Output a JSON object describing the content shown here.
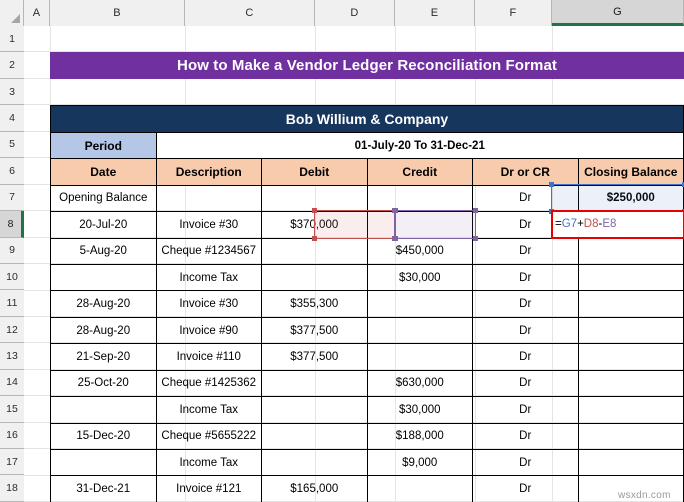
{
  "app": {
    "type": "spreadsheet",
    "watermark": "wsxdn.com"
  },
  "grid": {
    "columns": [
      {
        "letter": "A",
        "width": 26
      },
      {
        "letter": "B",
        "width": 135
      },
      {
        "letter": "C",
        "width": 130
      },
      {
        "letter": "D",
        "width": 80
      },
      {
        "letter": "E",
        "width": 80
      },
      {
        "letter": "F",
        "width": 77
      },
      {
        "letter": "G",
        "width": 132
      }
    ],
    "selected_column": "G",
    "rows": [
      1,
      2,
      3,
      4,
      5,
      6,
      7,
      8,
      9,
      10,
      11,
      12,
      13,
      14,
      15,
      16,
      17,
      18
    ],
    "selected_row": 8,
    "active_cell": "G8"
  },
  "banner": {
    "title": "How to Make a Vendor Ledger Reconciliation Format",
    "background": "#7030A0",
    "text_color": "#FFFFFF"
  },
  "colors": {
    "company_header_bg": "#17365D",
    "period_label_bg": "#B4C7E7",
    "column_header_bg": "#F8CBAD",
    "active_border": "#E60000",
    "ref_blue": "#4472C4",
    "ref_red": "#C0504D",
    "ref_purple": "#8064A2",
    "selection_green": "#217346"
  },
  "sheet": {
    "company_name": "Bob Willium & Company",
    "period_label": "Period",
    "period_value": "01-July-20 To 31-Dec-21",
    "headers": [
      "Date",
      "Description",
      "Debit",
      "Credit",
      "Dr or CR",
      "Closing Balance"
    ],
    "rows": [
      {
        "row": 7,
        "date": "Opening Balance",
        "description": "",
        "debit": "",
        "credit": "",
        "drcr": "Dr",
        "closing": "$250,000"
      },
      {
        "row": 8,
        "date": "20-Jul-20",
        "description": "Invoice #30",
        "debit": "$370,000",
        "credit": "",
        "drcr": "Dr",
        "closing": "=G7+D8-E8"
      },
      {
        "row": 9,
        "date": "5-Aug-20",
        "description": "Cheque #1234567",
        "debit": "",
        "credit": "$450,000",
        "drcr": "Dr",
        "closing": ""
      },
      {
        "row": 10,
        "date": "",
        "description": "Income Tax",
        "debit": "",
        "credit": "$30,000",
        "drcr": "Dr",
        "closing": ""
      },
      {
        "row": 11,
        "date": "28-Aug-20",
        "description": "Invoice #30",
        "debit": "$355,300",
        "credit": "",
        "drcr": "Dr",
        "closing": ""
      },
      {
        "row": 12,
        "date": "28-Aug-20",
        "description": "Invoice #90",
        "debit": "$377,500",
        "credit": "",
        "drcr": "Dr",
        "closing": ""
      },
      {
        "row": 13,
        "date": "21-Sep-20",
        "description": "Invoice #110",
        "debit": "$377,500",
        "credit": "",
        "drcr": "Dr",
        "closing": ""
      },
      {
        "row": 14,
        "date": "25-Oct-20",
        "description": "Cheque #1425362",
        "debit": "",
        "credit": "$630,000",
        "drcr": "Dr",
        "closing": ""
      },
      {
        "row": 15,
        "date": "",
        "description": "Income Tax",
        "debit": "",
        "credit": "$30,000",
        "drcr": "Dr",
        "closing": ""
      },
      {
        "row": 16,
        "date": "15-Dec-20",
        "description": "Cheque #5655222",
        "debit": "",
        "credit": "$188,000",
        "drcr": "Dr",
        "closing": ""
      },
      {
        "row": 17,
        "date": "",
        "description": "Income Tax",
        "debit": "",
        "credit": "$9,000",
        "drcr": "Dr",
        "closing": ""
      },
      {
        "row": 18,
        "date": "31-Dec-21",
        "description": "Invoice #121",
        "debit": "$165,000",
        "credit": "",
        "drcr": "Dr",
        "closing": ""
      }
    ]
  },
  "formula": {
    "full": "=G7+D8-E8",
    "tokens": [
      {
        "text": "=",
        "role": "operator"
      },
      {
        "text": "G7",
        "role": "ref-blue"
      },
      {
        "text": "+",
        "role": "operator"
      },
      {
        "text": "D8",
        "role": "ref-red"
      },
      {
        "text": "-",
        "role": "operator"
      },
      {
        "text": "E8",
        "role": "ref-purple"
      }
    ]
  }
}
